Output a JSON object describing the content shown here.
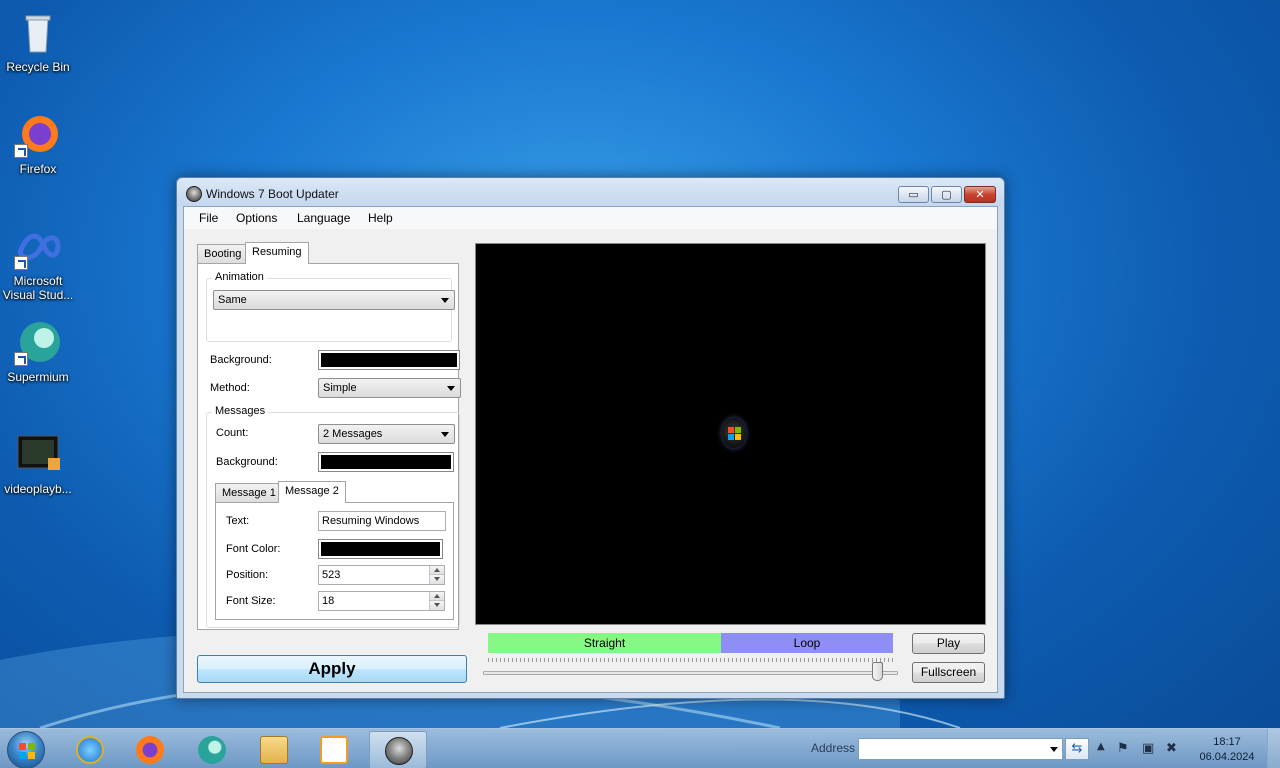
{
  "desktop": {
    "icons": [
      {
        "label": "Recycle Bin",
        "icon": "recycle-bin-icon"
      },
      {
        "label": "Firefox",
        "icon": "firefox-icon"
      },
      {
        "label": "Microsoft Visual Stud...",
        "icon": "visual-studio-icon"
      },
      {
        "label": "Supermium",
        "icon": "supermium-icon"
      },
      {
        "label": "videoplayb...",
        "icon": "video-file-icon"
      }
    ]
  },
  "window": {
    "title": "Windows 7 Boot Updater",
    "controls": {
      "minimize": "▭",
      "maximize": "▢",
      "close": "✕"
    },
    "menu": [
      "File",
      "Options",
      "Language",
      "Help"
    ],
    "tabs": [
      "Booting",
      "Resuming"
    ],
    "active_tab": "Resuming",
    "animation": {
      "group_label": "Animation",
      "selected": "Same"
    },
    "background_label": "Background:",
    "method": {
      "label": "Method:",
      "selected": "Simple"
    },
    "messages": {
      "group_label": "Messages",
      "count_label": "Count:",
      "count_selected": "2 Messages",
      "background_label": "Background:",
      "tabs": [
        "Message 1",
        "Message 2"
      ],
      "active_tab": "Message 2",
      "text_label": "Text:",
      "text_value": "Resuming Windows",
      "font_color_label": "Font Color:",
      "position_label": "Position:",
      "position_value": "523",
      "font_size_label": "Font Size:",
      "font_size_value": "18"
    },
    "apply_label": "Apply",
    "timeline": {
      "straight_label": "Straight",
      "loop_label": "Loop",
      "slider_position": 0.95
    },
    "play_label": "Play",
    "fullscreen_label": "Fullscreen"
  },
  "taskbar": {
    "pinned": [
      "internet-explorer-icon",
      "firefox-icon",
      "supermium-icon",
      "explorer-folder-icon",
      "media-player-icon",
      "boot-updater-icon"
    ],
    "address_label": "Address",
    "address_value": "",
    "clock_time": "18:17",
    "clock_date": "06.04.2024"
  },
  "colors": {
    "straight": "#84f784",
    "loop": "#8f8ef6",
    "preview_bg": "#000000",
    "swatch": "#000000"
  }
}
